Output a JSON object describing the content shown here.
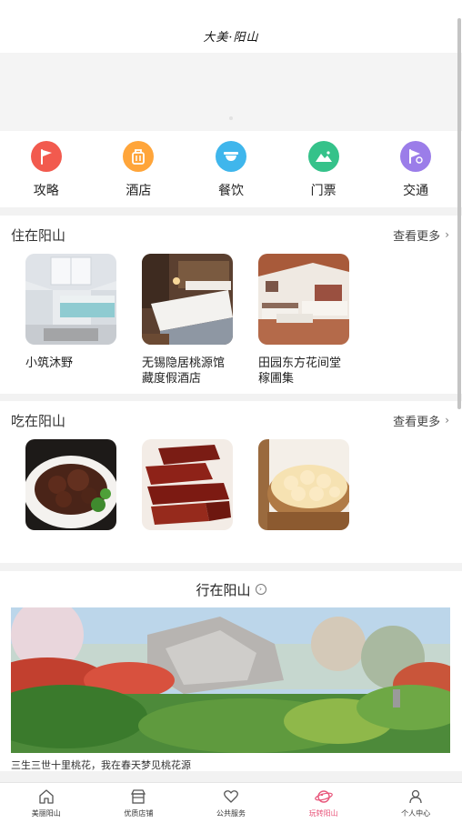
{
  "header": {
    "logo_text": "大美·阳山"
  },
  "quick_nav": [
    {
      "label": "攻略",
      "icon": "flag-icon",
      "color": "#f25a4e"
    },
    {
      "label": "酒店",
      "icon": "briefcase-icon",
      "color": "#ffa53a"
    },
    {
      "label": "餐饮",
      "icon": "bowl-icon",
      "color": "#3fb6ec"
    },
    {
      "label": "门票",
      "icon": "mountain-ticket-icon",
      "color": "#35c28a"
    },
    {
      "label": "交通",
      "icon": "route-icon",
      "color": "#9b7de9"
    }
  ],
  "stay": {
    "title": "住在阳山",
    "more": "查看更多",
    "items": [
      {
        "name": "小筑沐野"
      },
      {
        "name": "无锡隐居桃源馆藏度假酒店"
      },
      {
        "name": "田园东方花间堂稼圃集"
      }
    ]
  },
  "eat": {
    "title": "吃在阳山",
    "more": "查看更多"
  },
  "travel": {
    "title": "行在阳山",
    "caption": "三生三世十里桃花，我在春天梦见桃花源"
  },
  "tabbar": {
    "items": [
      {
        "label": "美丽阳山",
        "icon": "home-icon"
      },
      {
        "label": "优质店铺",
        "icon": "store-icon"
      },
      {
        "label": "公共服务",
        "icon": "heart-icon"
      },
      {
        "label": "玩转阳山",
        "icon": "planet-icon",
        "active": true
      },
      {
        "label": "个人中心",
        "icon": "user-icon"
      }
    ]
  }
}
